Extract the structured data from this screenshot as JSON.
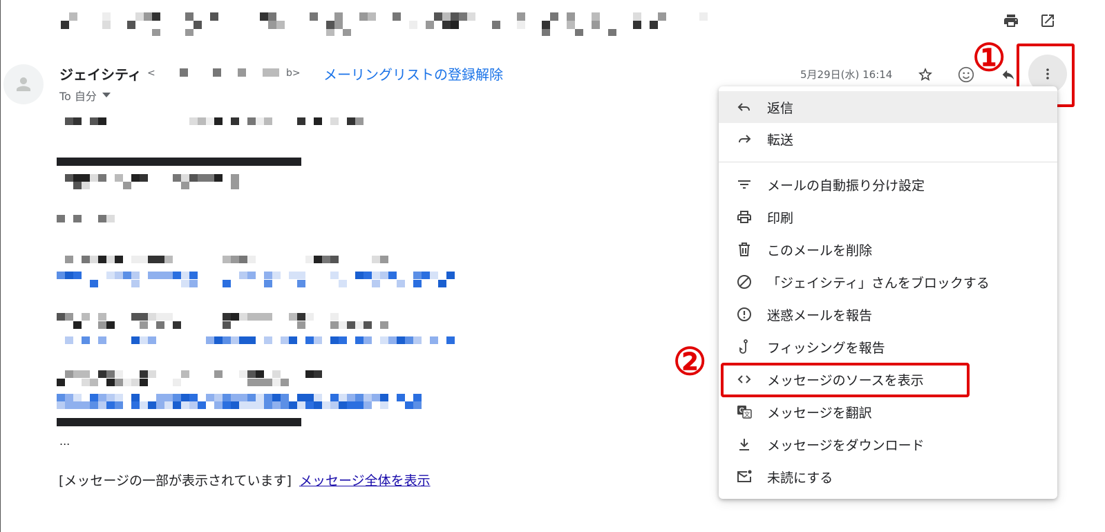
{
  "icons": {
    "print": "printer-icon",
    "open_new_window": "open-in-new-window-icon",
    "avatar": "person-icon",
    "to_dropdown": "caret-down-icon",
    "star": "star-icon",
    "emoji": "emoji-icon",
    "reply": "reply-icon",
    "more": "more-vert-icon"
  },
  "email": {
    "sender_name": "ジェイシティ",
    "sender_email_open": "<",
    "sender_email_close": "b>",
    "unsubscribe_link": "メーリングリストの登録解除",
    "to_label": "To 自分",
    "date": "5月29日(水) 16:14",
    "ellipsis": "...",
    "partial_notice": "[メッセージの一部が表示されています]",
    "show_full_link": "メッセージ全体を表示"
  },
  "annotations": {
    "step1": "①",
    "step2": "②",
    "color": "#e10000"
  },
  "menu": {
    "items": [
      {
        "label": "返信",
        "icon": "reply-icon"
      },
      {
        "label": "転送",
        "icon": "forward-icon"
      },
      {
        "label": "メールの自動振り分け設定",
        "icon": "filter-icon"
      },
      {
        "label": "印刷",
        "icon": "printer-icon"
      },
      {
        "label": "このメールを削除",
        "icon": "trash-icon"
      },
      {
        "label": "「ジェイシティ」さんをブロックする",
        "icon": "block-icon"
      },
      {
        "label": "迷惑メールを報告",
        "icon": "report-spam-icon"
      },
      {
        "label": "フィッシングを報告",
        "icon": "phishing-hook-icon"
      },
      {
        "label": "メッセージのソースを表示",
        "icon": "code-icon"
      },
      {
        "label": "メッセージを翻訳",
        "icon": "translate-icon"
      },
      {
        "label": "メッセージをダウンロード",
        "icon": "download-icon"
      },
      {
        "label": "未読にする",
        "icon": "mark-unread-icon"
      }
    ]
  },
  "colors": {
    "link": "#1a73e8",
    "annotation_red": "#e10000",
    "menu_highlight": "#eeeeee"
  }
}
